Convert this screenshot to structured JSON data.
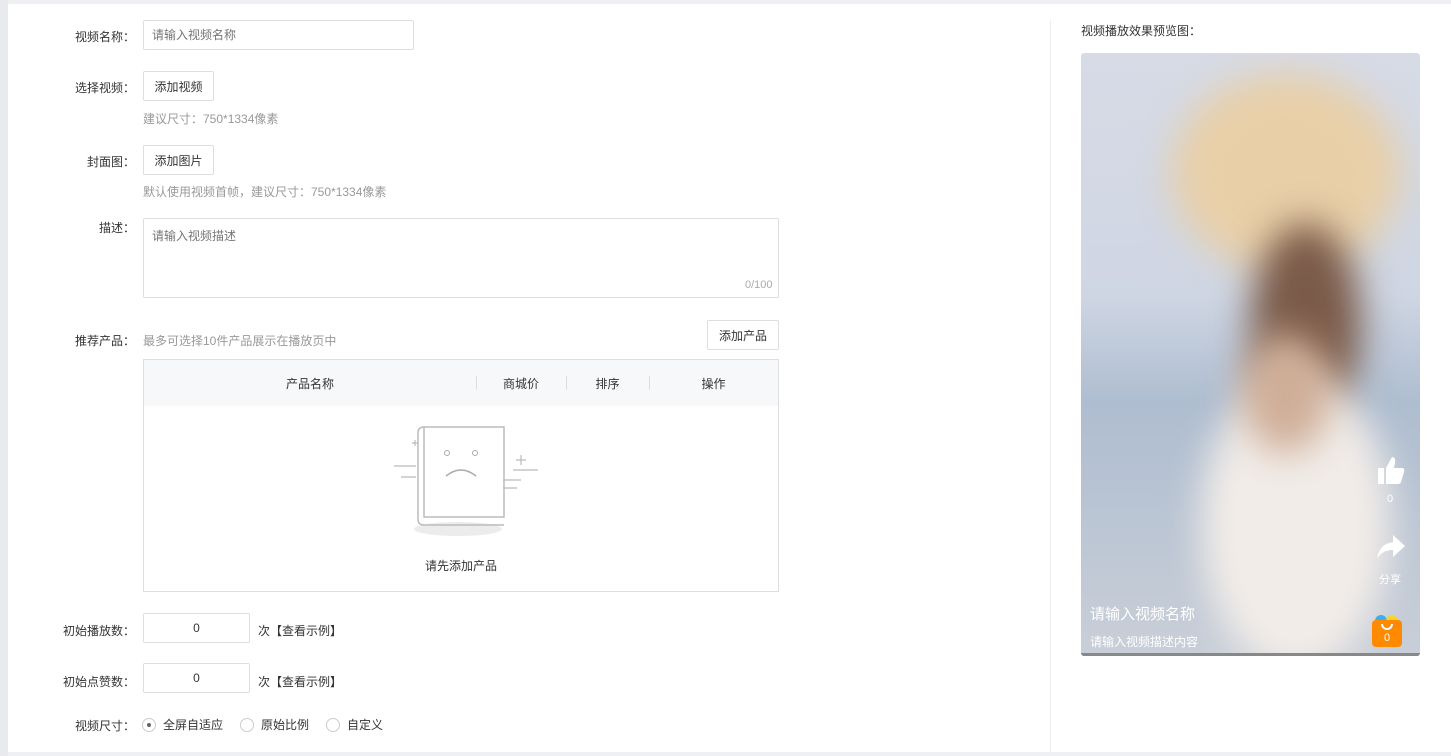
{
  "form": {
    "name_label": "视频名称：",
    "name_placeholder": "请输入视频名称",
    "video_label": "选择视频：",
    "video_button": "添加视频",
    "video_hint": "建议尺寸：750*1334像素",
    "cover_label": "封面图：",
    "cover_button": "添加图片",
    "cover_hint": "默认使用视频首帧，建议尺寸：750*1334像素",
    "desc_label": "描述：",
    "desc_placeholder": "请输入视频描述",
    "desc_counter": "0/100",
    "products_label": "推荐产品：",
    "products_hint": "最多可选择10件产品展示在播放页中",
    "add_product_button": "添加产品",
    "table_headers": [
      "产品名称",
      "商城价",
      "排序",
      "操作"
    ],
    "empty_text": "请先添加产品",
    "play_label": "初始播放数：",
    "play_value": "0",
    "play_unit": "次",
    "play_example": "【查看示例】",
    "like_label": "初始点赞数：",
    "like_value": "0",
    "like_unit": "次",
    "like_example": "【查看示例】",
    "size_label": "视频尺寸：",
    "size_options": [
      "全屏自适应",
      "原始比例",
      "自定义"
    ],
    "size_selected": "全屏自适应"
  },
  "preview": {
    "title": "视频播放效果预览图：",
    "like_count": "0",
    "share_label": "分享",
    "video_name": "请输入视频名称",
    "video_desc": "请输入视频描述内容",
    "cart_count": "0"
  }
}
